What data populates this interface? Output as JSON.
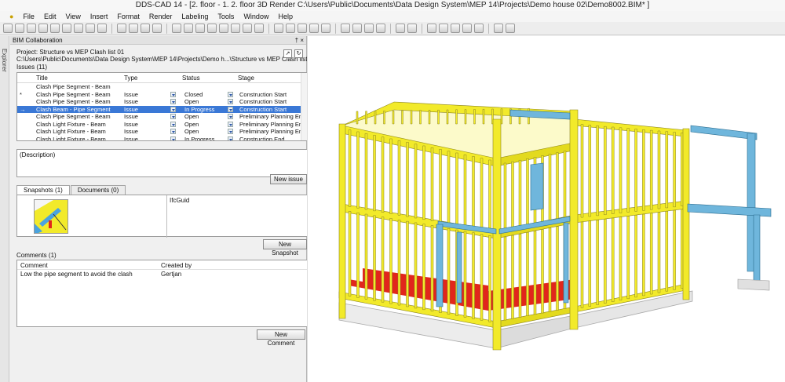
{
  "window": {
    "title": "DDS-CAD 14 - [2. floor - 1. 2. floor  3D  Render  C:\\Users\\Public\\Documents\\Data Design System\\MEP 14\\Projects\\Demo house 02\\Demo8002.BIM* ]"
  },
  "menu": [
    "File",
    "Edit",
    "View",
    "Insert",
    "Format",
    "Render",
    "Labeling",
    "Tools",
    "Window",
    "Help"
  ],
  "explorer_tab": "Explorer",
  "panel": {
    "title": "BIM Collaboration",
    "controls": "† ×",
    "project": "Project:  Structure vs MEP Clash list 01",
    "path": "C:\\Users\\Public\\Documents\\Data Design System\\MEP 14\\Projects\\Demo h...\\Structure vs MEP Clash list 01.bcf.zip",
    "issues_label": "Issues (11)",
    "columns": {
      "title": "Title",
      "type": "Type",
      "status": "Status",
      "stage": "Stage"
    },
    "issues": [
      {
        "marker": "",
        "title": "Clash Pipe Segment - Beam",
        "type": "",
        "status": "",
        "stage": ""
      },
      {
        "marker": "*",
        "title": "Clash Pipe Segment - Beam",
        "type": "Issue",
        "status": "Closed",
        "stage": "Construction Start"
      },
      {
        "marker": "",
        "title": "Clash Pipe Segment - Beam",
        "type": "Issue",
        "status": "Open",
        "stage": "Construction Start"
      },
      {
        "marker": "→",
        "title": "Clash Beam - Pipe Segment",
        "type": "Issue",
        "status": "In Progress",
        "stage": "Construction Start"
      },
      {
        "marker": "",
        "title": "Clash Pipe Segment - Beam",
        "type": "Issue",
        "status": "Open",
        "stage": "Preliminary Planning End"
      },
      {
        "marker": "",
        "title": "Clash Light Fixture - Beam",
        "type": "Issue",
        "status": "Open",
        "stage": "Preliminary Planning End"
      },
      {
        "marker": "",
        "title": "Clash Light Fixture - Beam",
        "type": "Issue",
        "status": "Open",
        "stage": "Preliminary Planning End"
      },
      {
        "marker": "",
        "title": "Clash Light Fixture - Beam",
        "type": "Issue",
        "status": "In Progress",
        "stage": "Construction End"
      }
    ],
    "selected_issue": 3,
    "description_placeholder": "(Description)",
    "new_issue": "New issue",
    "tabs": [
      "Snapshots (1)",
      "Documents (0)"
    ],
    "ifc_guid_label": "IfcGuid",
    "new_snapshot": "New Snapshot",
    "comments_label": "Comments (1)",
    "comment_cols": {
      "comment": "Comment",
      "created_by": "Created by"
    },
    "comments": [
      {
        "text": "Low the pipe segment to avoid the clash",
        "author": "Gertjan"
      }
    ],
    "new_comment": "New Comment"
  },
  "colors": {
    "frame_yellow": "#f2ea2a",
    "slab_red": "#e1261c",
    "beam_blue": "#6fb6dc",
    "selection": "#3a78d6"
  }
}
